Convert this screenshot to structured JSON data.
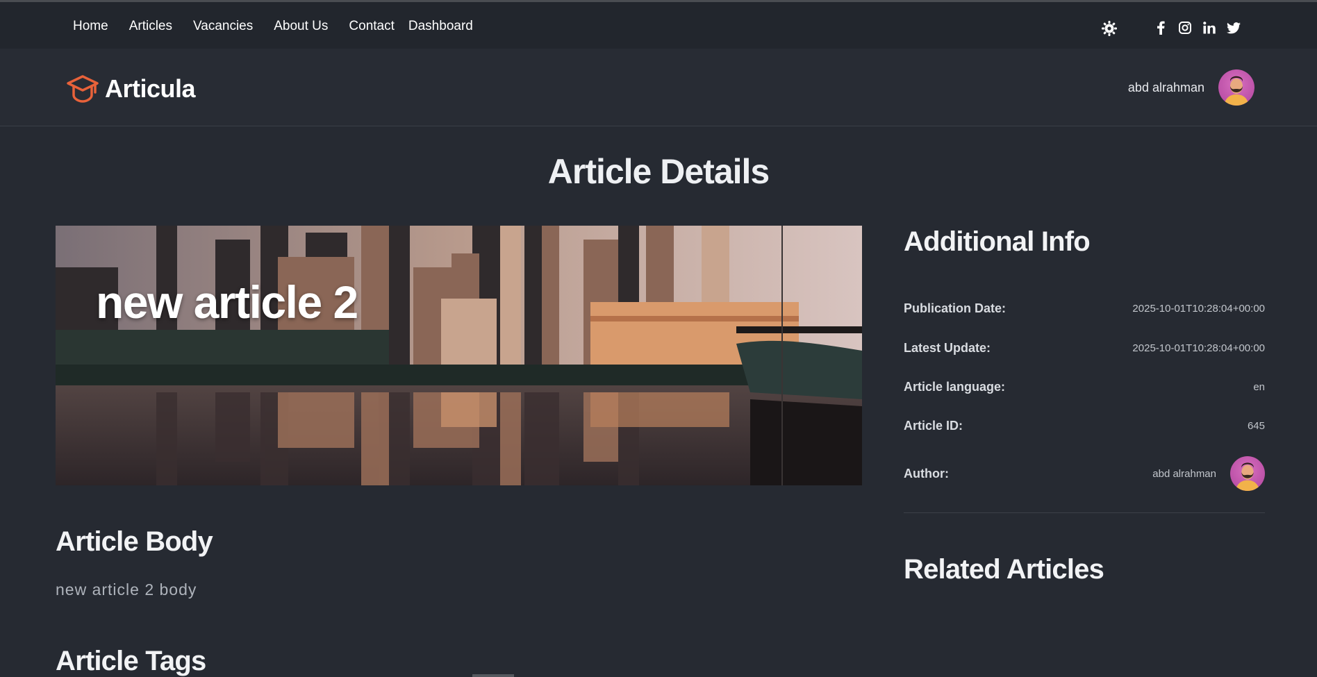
{
  "topnav": {
    "links": [
      "Home",
      "Articles",
      "Vacancies",
      "About Us",
      "Contact",
      "Dashboard"
    ],
    "theme_toggle_icon": "sun-gear-icon",
    "social_icons": [
      "facebook-icon",
      "instagram-icon",
      "linkedin-icon",
      "twitter-icon"
    ]
  },
  "header": {
    "brand": "Articula",
    "brand_icon": "graduation-cap-icon",
    "brand_color": "#e8623a",
    "user_name": "abd alrahman"
  },
  "page": {
    "title": "Article Details"
  },
  "article": {
    "title": "new article 2",
    "body_heading": "Article Body",
    "body": "new article 2 body",
    "tags_heading": "Article Tags"
  },
  "sidebar": {
    "info_heading": "Additional Info",
    "rows": [
      {
        "label": "Publication Date:",
        "value": "2025-10-01T10:28:04+00:00"
      },
      {
        "label": "Latest Update:",
        "value": "2025-10-01T10:28:04+00:00"
      },
      {
        "label": "Article language:",
        "value": "en"
      },
      {
        "label": "Article ID:",
        "value": "645"
      }
    ],
    "author_label": "Author:",
    "author_name": "abd alrahman",
    "related_heading": "Related Articles"
  }
}
